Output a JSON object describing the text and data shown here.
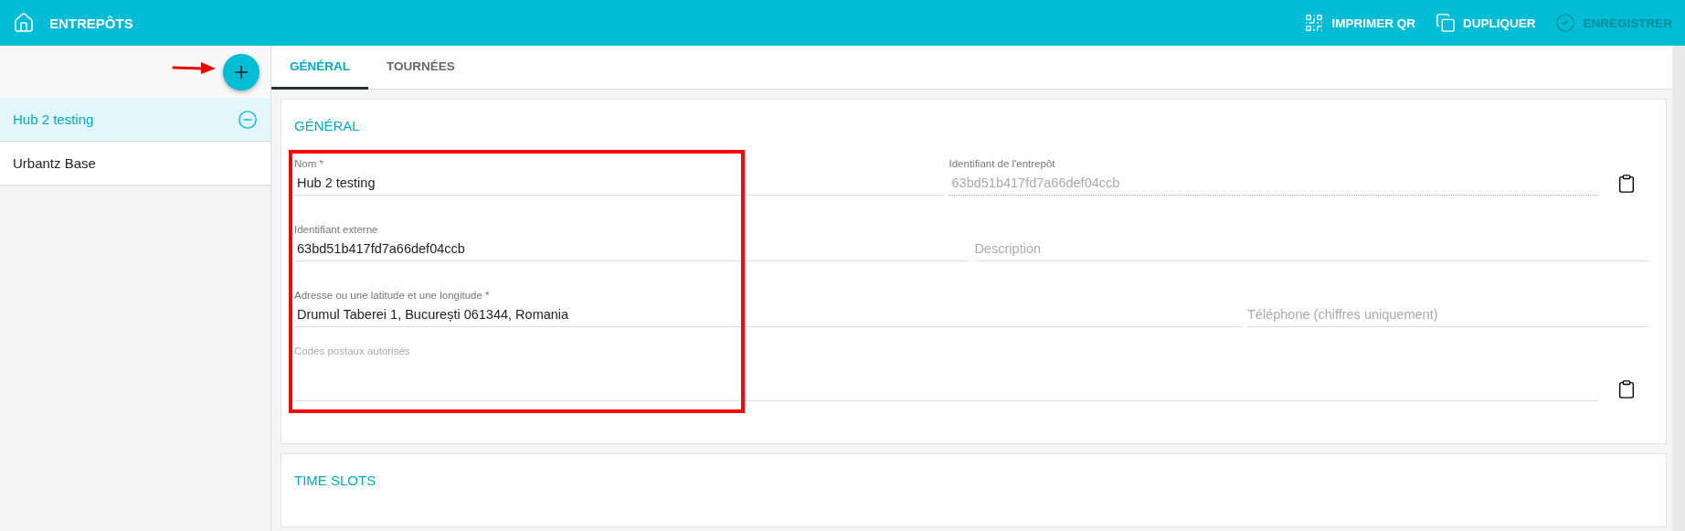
{
  "topbar": {
    "title": "ENTREPÔTS",
    "actions": [
      {
        "label": "IMPRIMER QR",
        "disabled": false
      },
      {
        "label": "DUPLIQUER",
        "disabled": false
      },
      {
        "label": "ENREGISTRER",
        "disabled": true
      }
    ]
  },
  "sidebar": {
    "items": [
      {
        "label": "Hub 2 testing",
        "selected": true
      },
      {
        "label": "Urbantz Base",
        "selected": false
      }
    ]
  },
  "tabs": [
    {
      "label": "GÉNÉRAL",
      "selected": true
    },
    {
      "label": "TOURNÉES",
      "selected": false
    }
  ],
  "cards": [
    {
      "title": "GÉNÉRAL",
      "rows": [
        [
          {
            "label": "Nom *",
            "value": "Hub 2 testing",
            "disabled": false
          },
          {
            "label": "Identifiant de l'entrepôt",
            "value": "63bd51b417fd7a66def04ccb",
            "disabled": true,
            "copy": true
          }
        ],
        [
          {
            "label": "Identifiant externe",
            "value": "63bd51b417fd7a66def04ccb",
            "disabled": false
          },
          {
            "placeholder": "Description",
            "disabled": false
          }
        ],
        [
          {
            "label": "Adresse ou une latitude et une longitude *",
            "value": "Drumul Taberei 1, București 061344, Romania",
            "disabled": false
          },
          {
            "placeholder": "Téléphone (chiffres uniquement)",
            "disabled": false
          }
        ],
        [
          {
            "label": "Codes postaux autorisés",
            "disabled": false,
            "copy": true
          }
        ]
      ]
    },
    {
      "title": "TIME SLOTS"
    }
  ]
}
